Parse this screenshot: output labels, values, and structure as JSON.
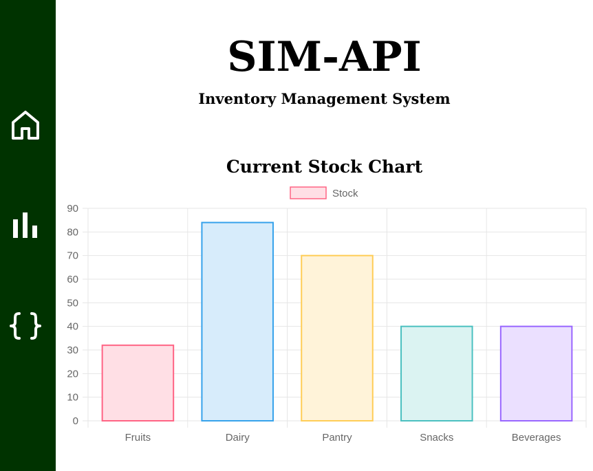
{
  "header": {
    "title": "SIM-API",
    "subtitle": "Inventory Management System"
  },
  "sidebar": {
    "items": [
      {
        "icon": "home-icon"
      },
      {
        "icon": "bar-chart-icon"
      },
      {
        "icon": "braces-icon"
      }
    ]
  },
  "colors": {
    "sidebar": "#003300",
    "grid": "#e6e6e6",
    "tick_text": "#666666"
  },
  "chart_data": {
    "type": "bar",
    "title": "Current Stock Chart",
    "categories": [
      "Fruits",
      "Dairy",
      "Pantry",
      "Snacks",
      "Beverages"
    ],
    "series": [
      {
        "name": "Stock",
        "values": [
          32,
          84,
          70,
          40,
          40
        ]
      }
    ],
    "bar_fills": [
      "#ffdfe5",
      "#d7ecfb",
      "#fff3d9",
      "#dbf3f2",
      "#ebe0ff"
    ],
    "bar_strokes": [
      "#ff6384",
      "#36a2eb",
      "#ffcd56",
      "#4bc0c0",
      "#9966ff"
    ],
    "legend": {
      "position": "top",
      "fill": "#ffdfe5",
      "stroke": "#ff6384"
    },
    "ylim": [
      0,
      90
    ],
    "yticks": [
      0,
      10,
      20,
      30,
      40,
      50,
      60,
      70,
      80,
      90
    ],
    "grid": true,
    "xlabel": "",
    "ylabel": ""
  }
}
